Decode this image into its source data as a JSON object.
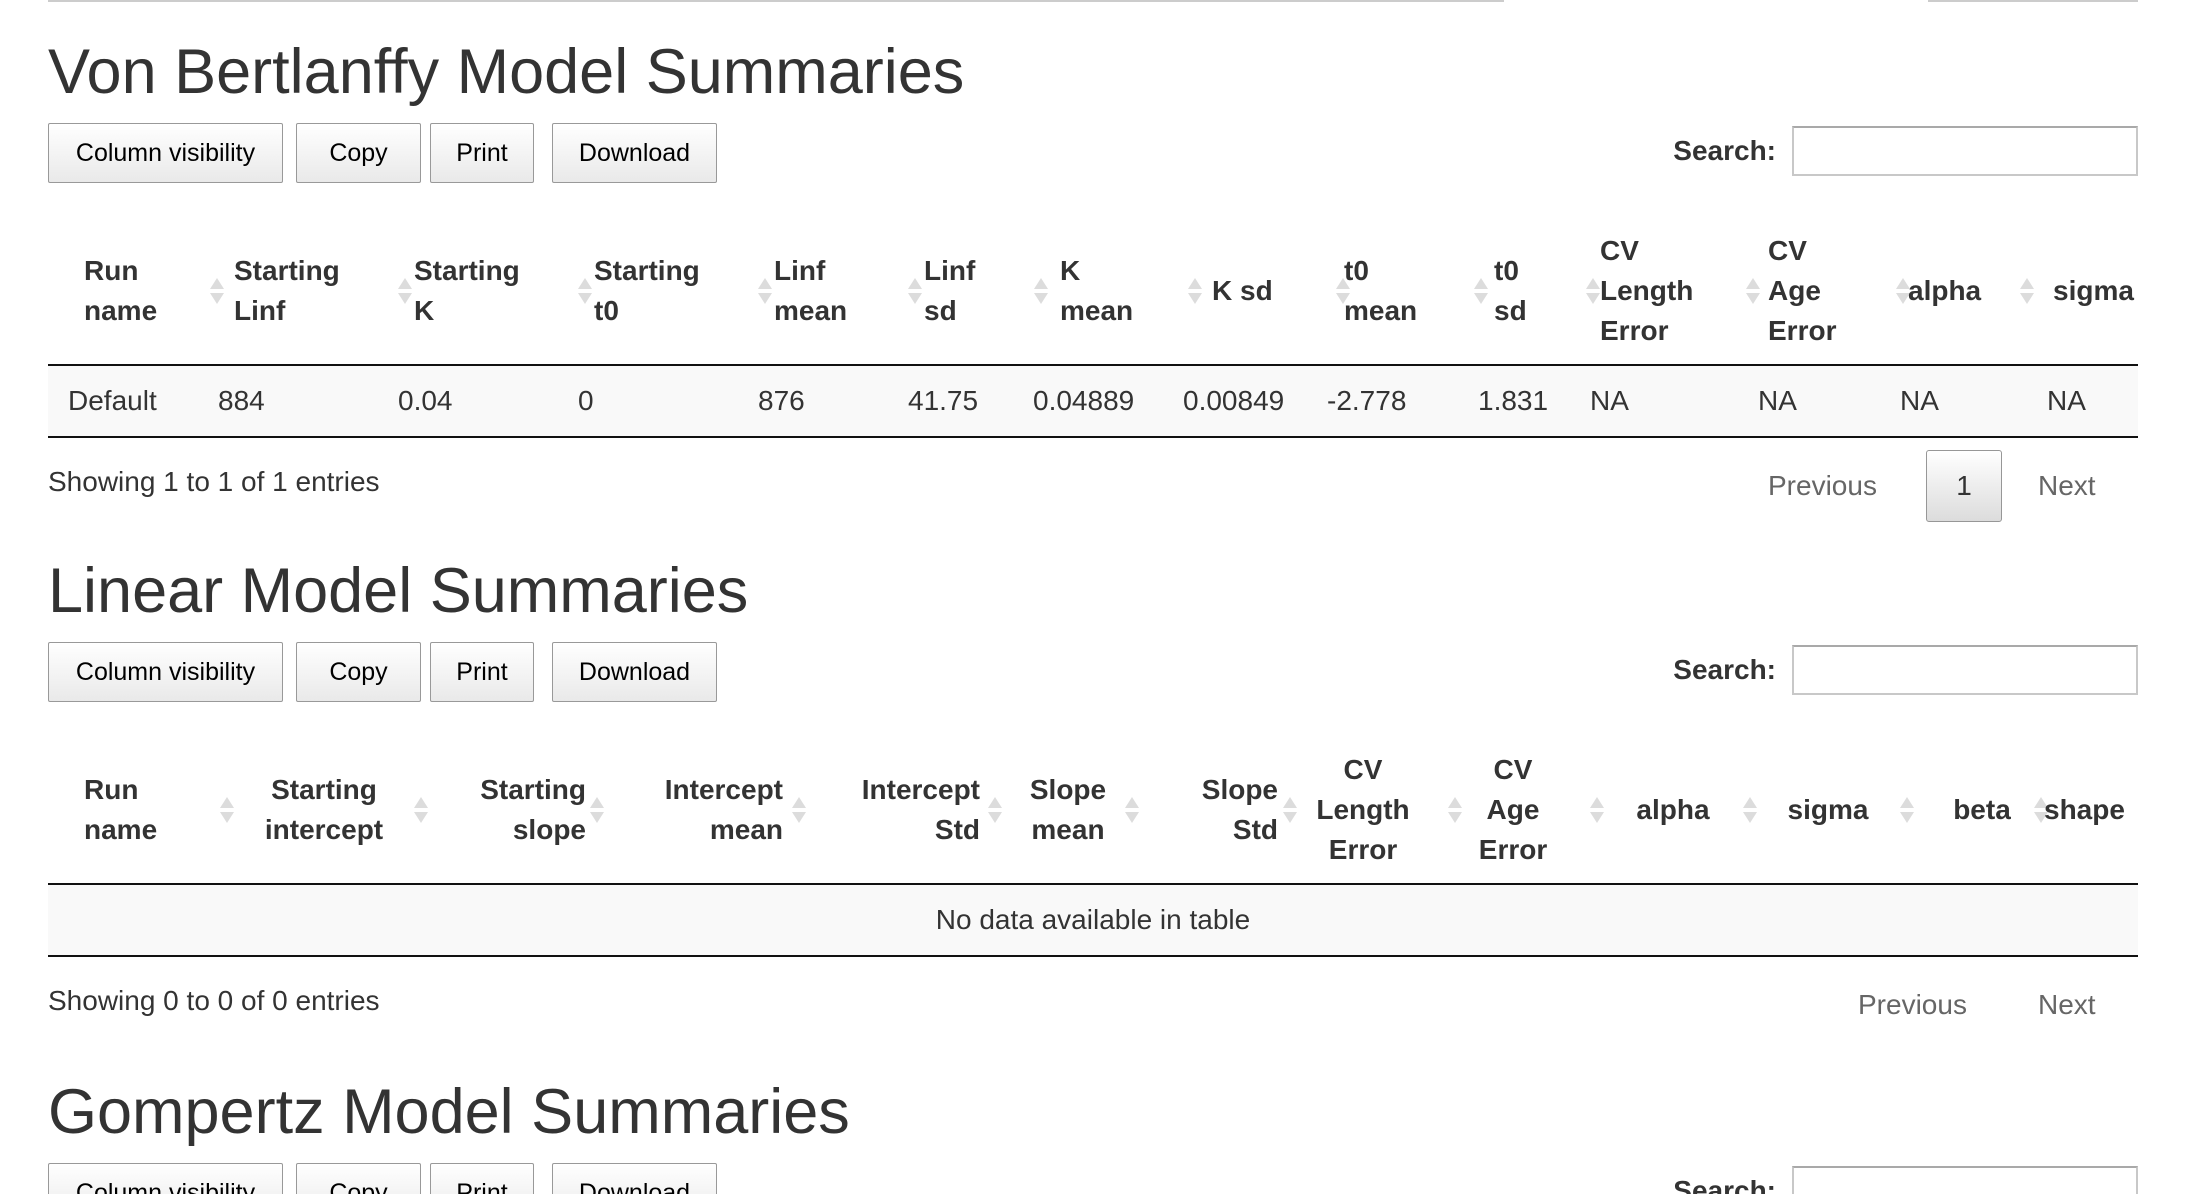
{
  "buttons": {
    "colvis": "Column visibility",
    "copy": "Copy",
    "print": "Print",
    "download": "Download"
  },
  "search_label": "Search:",
  "pager": {
    "previous": "Previous",
    "next": "Next"
  },
  "vb": {
    "title": "Von Bertlanffy Model Summaries",
    "headers": {
      "run_name": [
        "Run",
        "name"
      ],
      "starting_linf": [
        "Starting",
        "Linf"
      ],
      "starting_k": [
        "Starting",
        "K"
      ],
      "starting_t0": [
        "Starting",
        "t0"
      ],
      "linf_mean": [
        "Linf",
        "mean"
      ],
      "linf_sd": [
        "Linf",
        "sd"
      ],
      "k_mean": [
        "K",
        "mean"
      ],
      "k_sd": [
        "K sd"
      ],
      "t0_mean": [
        "t0",
        "mean"
      ],
      "t0_sd": [
        "t0",
        "sd"
      ],
      "cv_length": [
        "CV",
        "Length",
        "Error"
      ],
      "cv_age": [
        "CV",
        "Age",
        "Error"
      ],
      "alpha": [
        "alpha"
      ],
      "sigma": [
        "sigma"
      ]
    },
    "row": {
      "run_name": "Default",
      "starting_linf": "884",
      "starting_k": "0.04",
      "starting_t0": "0",
      "linf_mean": "876",
      "linf_sd": "41.75",
      "k_mean": "0.04889",
      "k_sd": "0.00849",
      "t0_mean": "-2.778",
      "t0_sd": "1.831",
      "cv_length": "NA",
      "cv_age": "NA",
      "alpha": "NA",
      "sigma": "NA"
    },
    "info": "Showing 1 to 1 of 1 entries",
    "current_page": "1"
  },
  "linear": {
    "title": "Linear Model Summaries",
    "headers": {
      "run_name": [
        "Run",
        "name"
      ],
      "starting_intercept": [
        "Starting",
        "intercept"
      ],
      "starting_slope": [
        "Starting",
        "slope"
      ],
      "intercept_mean": [
        "Intercept",
        "mean"
      ],
      "intercept_std": [
        "Intercept",
        "Std"
      ],
      "slope_mean": [
        "Slope",
        "mean"
      ],
      "slope_std": [
        "Slope",
        "Std"
      ],
      "cv_length": [
        "CV",
        "Length",
        "Error"
      ],
      "cv_age": [
        "CV",
        "Age",
        "Error"
      ],
      "alpha": [
        "alpha"
      ],
      "sigma": [
        "sigma"
      ],
      "beta": [
        "beta"
      ],
      "shape": [
        "shape"
      ]
    },
    "empty": "No data available in table",
    "info": "Showing 0 to 0 of 0 entries"
  },
  "gompertz": {
    "title": "Gompertz Model Summaries"
  }
}
